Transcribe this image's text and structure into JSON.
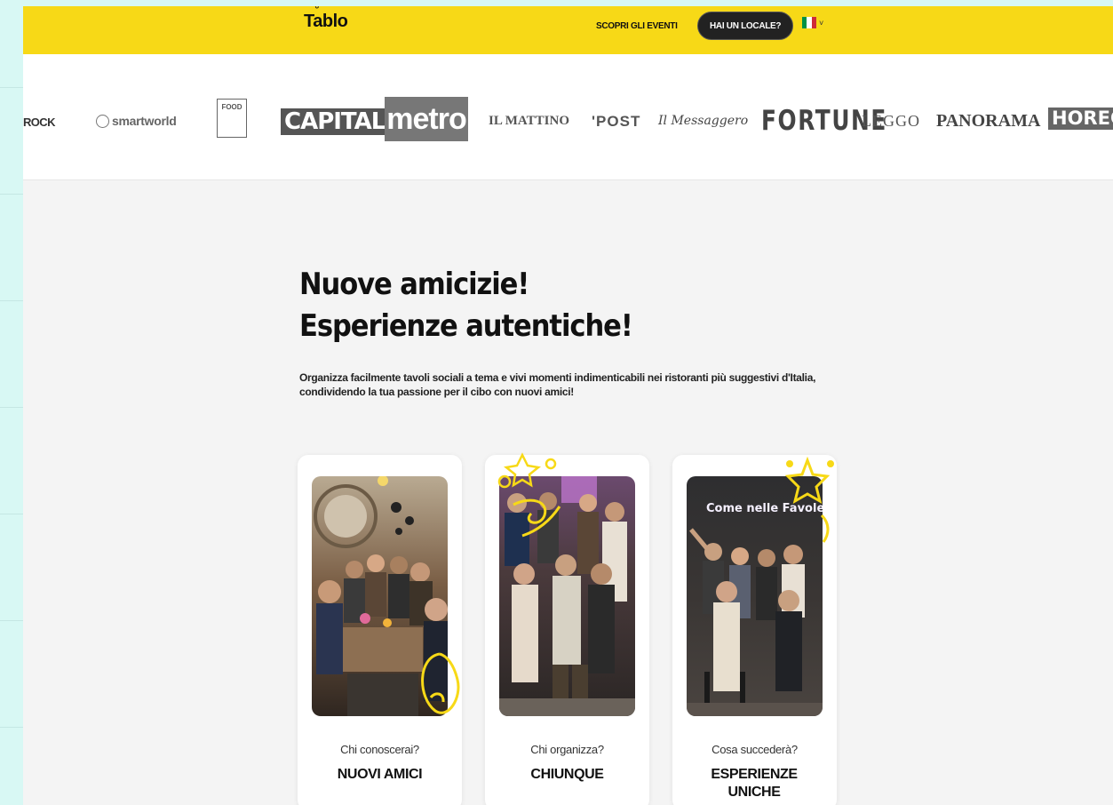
{
  "header": {
    "logo_text": "Tablo",
    "logo_mark": "˘ᵕ˘",
    "nav_link": "SCOPRI GLI EVENTI",
    "cta": "HAI UN LOCALE?",
    "language_chevron": "˅",
    "flag_colors": [
      "#009246",
      "#ffffff",
      "#ce2b37"
    ]
  },
  "press_logos": {
    "rock": "ROCK",
    "smartworld": "smartworld",
    "food": "FOOD",
    "capital": "CAPITAL",
    "metro": "metro",
    "mattino": "IL MATTINO",
    "post": "'POST",
    "messaggero": "Il Messaggero",
    "fortune": "FORTUNE",
    "leggo": "LEGGO",
    "panorama": "PANORAMA",
    "horeca": "HORECA"
  },
  "hero": {
    "title_line1": "Nuove amicizie!",
    "title_line2": "Esperienze autentiche!",
    "subtitle": "Organizza facilmente tavoli sociali a tema e vivi momenti indimenticabili nei ristoranti più suggestivi d'Italia, condividendo la tua passione per il cibo con nuovi amici!"
  },
  "cards": [
    {
      "kicker": "Chi conoscerai?",
      "title": "NUOVI AMICI"
    },
    {
      "kicker": "Chi organizza?",
      "title": "CHIUNQUE"
    },
    {
      "kicker": "Cosa succederà?",
      "title": "ESPERIENZE UNICHE",
      "neon_sign": "Come nelle Favole"
    }
  ],
  "colors": {
    "brand_yellow": "#f7d917",
    "frame_mint": "#d8f8f4",
    "cta_dark": "#222222"
  }
}
